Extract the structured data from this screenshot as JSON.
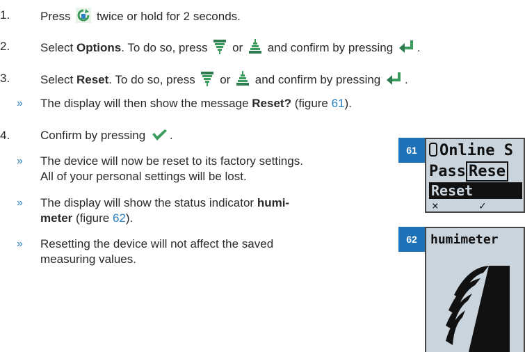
{
  "steps": [
    {
      "num": "1.",
      "pre": "Press",
      "post": "twice or hold for 2 seconds."
    },
    {
      "num": "2.",
      "pre": "Select",
      "bold": "Options",
      "mid": ". To do so, press",
      "or": "or",
      "post": "and confirm by pressing",
      "end": "."
    },
    {
      "num": "3.",
      "pre": "Select",
      "bold": "Reset",
      "mid": ". To do so, press",
      "or": "or",
      "post": "and confirm by pressing",
      "end": "."
    },
    {
      "bullet": "»",
      "pre": "The display will then show the message",
      "bold": "Reset?",
      "fig_pre": "(figure",
      "fig": "61",
      "fig_post": ")."
    },
    {
      "num": "4.",
      "pre": "Confirm by pressing",
      "end": "."
    },
    {
      "bullet": "»",
      "line1": "The device will now be reset to its factory settings.",
      "line2": "All of your personal settings will be lost."
    },
    {
      "bullet": "»",
      "pre": "The display will show the status indicator",
      "bold1": "humi-",
      "bold2": "meter",
      "fig_pre": "(figure",
      "fig": "62",
      "fig_post": ")."
    },
    {
      "bullet": "»",
      "line1": "Resetting the device will not affect the saved",
      "line2": "measuring values."
    }
  ],
  "figures": [
    {
      "label": "61",
      "row1": "Online S",
      "row2a": "Pass",
      "row2b": "Rese",
      "row3": "Reset",
      "soft1": "×",
      "soft2": "✓"
    },
    {
      "label": "62",
      "status": "humimeter"
    }
  ],
  "icons": [
    "menu-key-icon",
    "down-arrow-key-icon",
    "up-arrow-key-icon",
    "enter-key-icon",
    "check-key-icon"
  ],
  "colors": {
    "accent": "#2b80c0",
    "label_bg": "#1e73b8",
    "lcd_bg": "#c9d4dc"
  }
}
